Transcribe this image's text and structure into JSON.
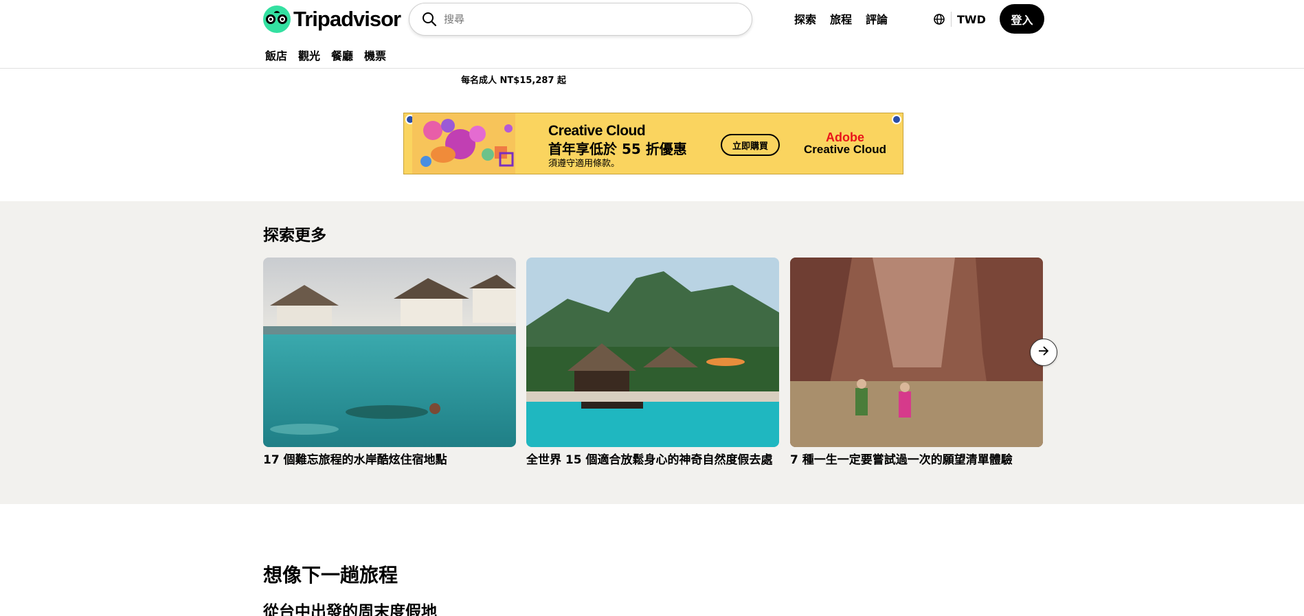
{
  "header": {
    "brand": "Tripadvisor",
    "search_placeholder": "搜尋",
    "nav": [
      "探索",
      "旅程",
      "評論"
    ],
    "currency": "TWD",
    "signin_label": "登入"
  },
  "subnav": [
    "飯店",
    "觀光",
    "餐廳",
    "機票"
  ],
  "price_note": "每名成人 NT$15,287 起",
  "ad": {
    "title": "Creative Cloud",
    "subtitle": "首年享低於 55 折優惠",
    "note": "須遵守適用條款。",
    "button": "立即購買",
    "brand_line1": "Adobe",
    "brand_line2": "Creative Cloud",
    "background": "#fad45f"
  },
  "explore": {
    "heading": "探索更多",
    "cards": [
      {
        "title": "17 個難忘旅程的水岸酷炫住宿地點",
        "image": "overwater-villas-snorkeler"
      },
      {
        "title": "全世界 15 個適合放鬆身心的神奇自然度假去處",
        "image": "tropical-resort-pool-mountains"
      },
      {
        "title": "7 種一生一定要嘗試過一次的願望清單體驗",
        "image": "canyon-hikers-river"
      }
    ],
    "next_icon": "arrow-right-icon",
    "background": "#f2f1ee"
  },
  "sections": {
    "imagine_heading": "想像下一趟旅程",
    "weekend_heading": "從台中出發的周末度假地"
  },
  "colors": {
    "brand_green": "#34e0a1",
    "signin_bg": "#000000"
  }
}
